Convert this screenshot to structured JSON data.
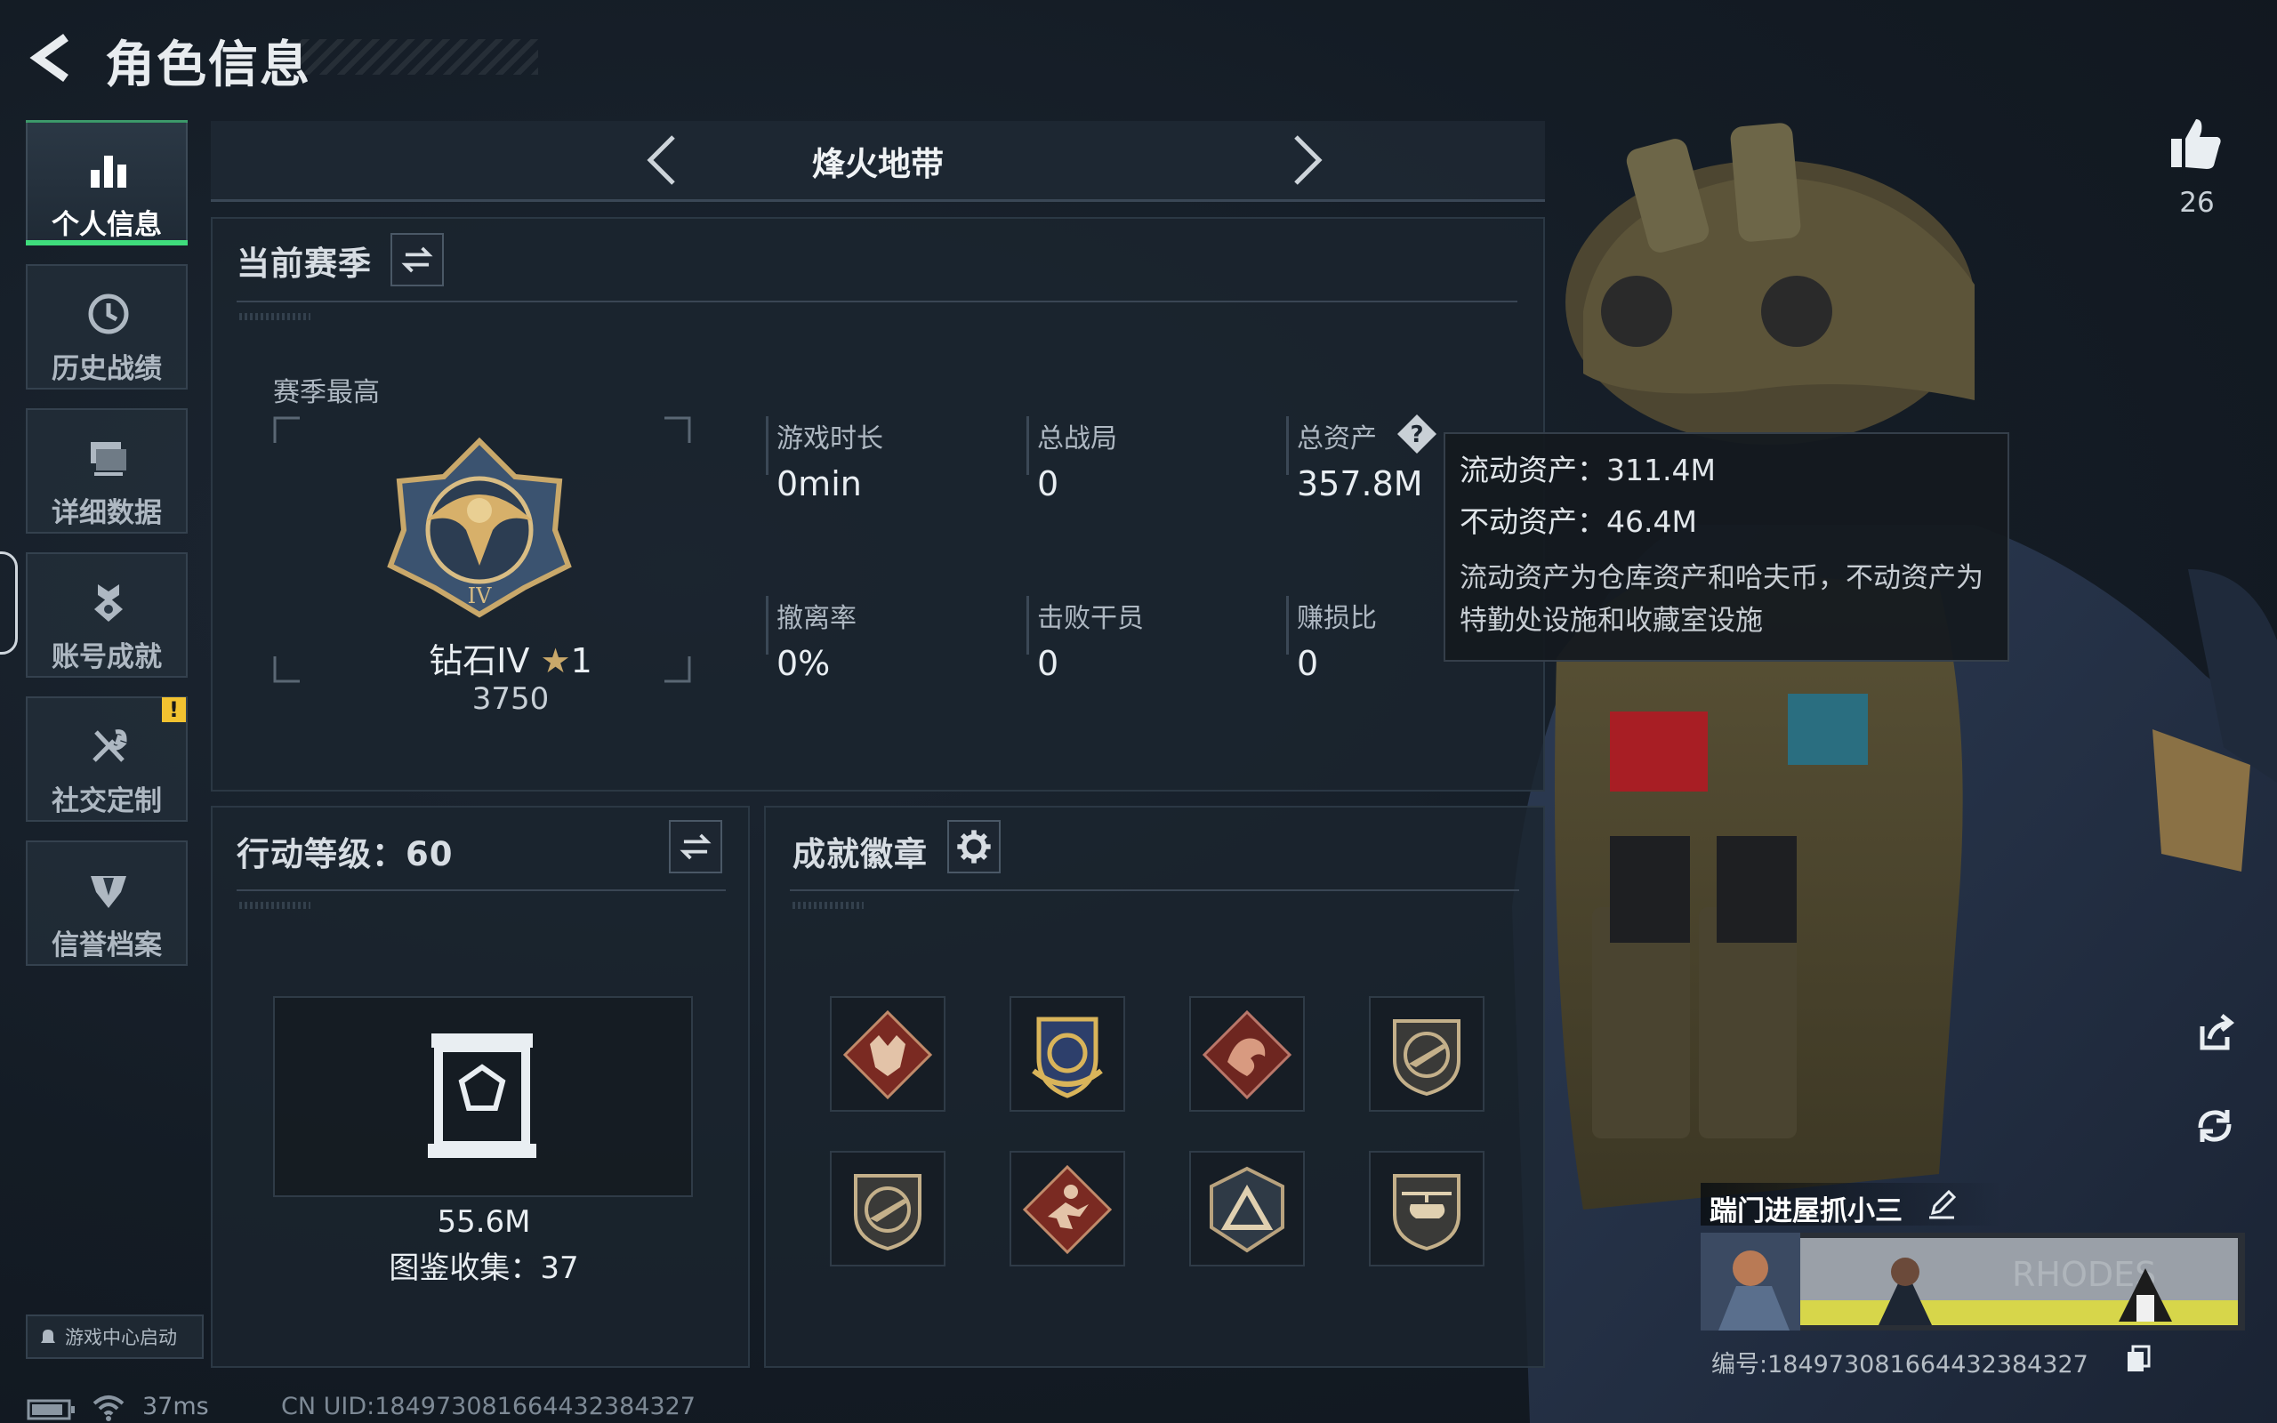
{
  "header": {
    "title": "角色信息"
  },
  "nav": {
    "items": [
      {
        "label": "个人信息",
        "icon": "bar-chart-icon",
        "active": true
      },
      {
        "label": "历史战绩",
        "icon": "history-clock-icon",
        "active": false
      },
      {
        "label": "详细数据",
        "icon": "monitor-icon",
        "active": false
      },
      {
        "label": "账号成就",
        "icon": "achievement-medal-icon",
        "active": false
      },
      {
        "label": "社交定制",
        "icon": "tools-icon",
        "active": false,
        "badge": "!"
      },
      {
        "label": "信誉档案",
        "icon": "credibility-shield-icon",
        "active": false
      }
    ],
    "launch_label": "游戏中心启动"
  },
  "mode": {
    "label": "烽火地带"
  },
  "season": {
    "title": "当前赛季",
    "best_label": "赛季最高",
    "rank_name": "钻石IV",
    "rank_stars": "1",
    "rank_score": "3750",
    "stats": [
      {
        "label": "游戏时长",
        "value": "0min"
      },
      {
        "label": "总战局",
        "value": "0"
      },
      {
        "label": "总资产",
        "value": "357.8M"
      },
      {
        "label": "撤离率",
        "value": "0%"
      },
      {
        "label": "击败干员",
        "value": "0"
      },
      {
        "label": "赚损比",
        "value": "0"
      }
    ]
  },
  "tooltip": {
    "liquid": "流动资产：311.4M",
    "fixed": "不动资产：46.4M",
    "desc": "流动资产为仓库资产和哈夫币，不动资产为特勤处设施和收藏室设施"
  },
  "level": {
    "title": "行动等级：60",
    "value": "55.6M",
    "collection": "图鉴收集：37"
  },
  "badges": {
    "title": "成就徽章",
    "items": [
      "wolf-badge-icon",
      "shield-eagle-badge-icon",
      "dragon-badge-icon",
      "rifle-badge-icon",
      "rifle-shield-badge-icon",
      "runner-badge-icon",
      "triangle-badge-icon",
      "helicopter-badge-icon"
    ]
  },
  "likes": {
    "count": "26"
  },
  "player": {
    "name": "踹门进屋抓小三",
    "uid_line": "编号:18497308166443238432​7"
  },
  "status": {
    "ping": "37ms",
    "cn_uid": "CN UID:18497308166443238432​7"
  },
  "colors": {
    "accent_green": "#3fdc7c",
    "warning_yellow": "#f2c230"
  }
}
